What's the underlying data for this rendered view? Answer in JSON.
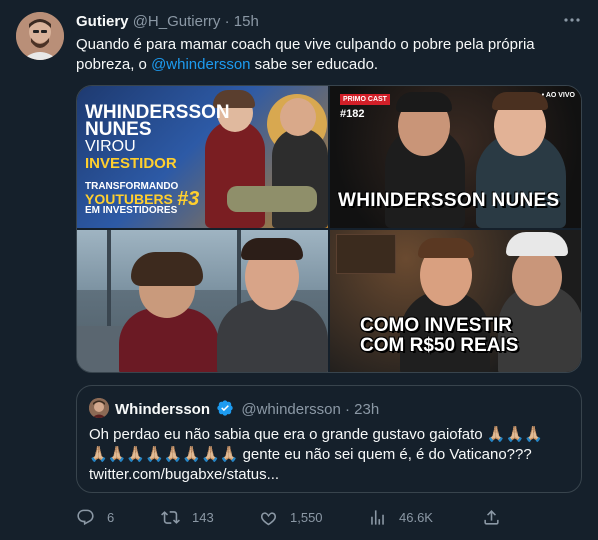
{
  "tweet": {
    "display_name": "Gutiery",
    "handle": "@H_Gutierry",
    "separator": "·",
    "time": "15h",
    "more_icon": "more-dots-icon",
    "text_before": "Quando é para mamar coach que vive culpando o pobre pela própria pobreza, o ",
    "mention": "@whindersson",
    "text_after": " sabe ser educado."
  },
  "media": {
    "thumb1": {
      "line1": "WHINDERSSON",
      "line2": "NUNES",
      "line3": "VIROU",
      "line4": "INVESTIDOR",
      "sub1": "TRANSFORMANDO",
      "sub2": "YOUTUBERS",
      "sub3": "EM INVESTIDORES",
      "number": "#3"
    },
    "thumb2": {
      "badge": "PRIMO CAST",
      "episode": "#182",
      "live": "• AO VIVO",
      "banner": "WHINDERSSON NUNES"
    },
    "thumb4": {
      "line1": "COMO INVESTIR",
      "line2": "COM R$50 REAIS"
    }
  },
  "quote": {
    "display_name": "Whindersson",
    "verified_icon": "verified-badge-icon",
    "handle": "@whindersson",
    "separator": "·",
    "time": "23h",
    "text_line1": "Oh perdao eu não sabia que era o grande gustavo gaiofato 🙏🏼🙏🏼🙏🏼",
    "text_line2": "🙏🏼🙏🏼🙏🏼🙏🏼🙏🏼🙏🏼🙏🏼🙏🏼 gente eu não sei quem é, é do Vaticano???",
    "text_line3": "twitter.com/bugabxe/status..."
  },
  "actions": {
    "reply_count": "6",
    "retweet_count": "143",
    "like_count": "1,550",
    "views_count": "46.6K"
  },
  "colors": {
    "background": "#15202b",
    "text": "#f7f9f9",
    "muted": "#8b98a5",
    "accent": "#1d9bf0",
    "border": "#38444d"
  }
}
